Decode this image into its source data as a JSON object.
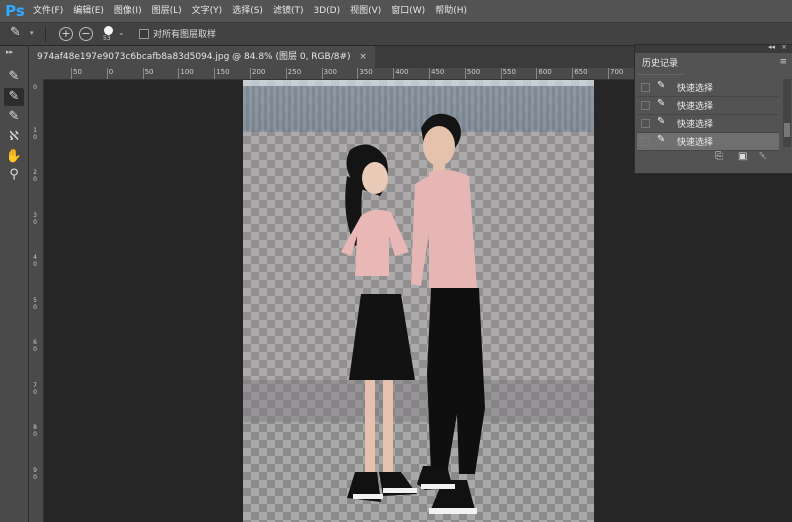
{
  "app": {
    "logo": "Ps"
  },
  "menu": [
    "文件(F)",
    "编辑(E)",
    "图像(I)",
    "图层(L)",
    "文字(Y)",
    "选择(S)",
    "滤镜(T)",
    "3D(D)",
    "视图(V)",
    "窗口(W)",
    "帮助(H)"
  ],
  "options": {
    "brush_size": "53",
    "sample_all_label": "对所有图层取样",
    "add_symbol": "+",
    "subtract_symbol": "−",
    "chevron": "⌄"
  },
  "document": {
    "tab_title": "974af48e197e9073c6bcafb8a83d5094.jpg @ 84.8% (图层 0, RGB/8#)",
    "close_glyph": "×"
  },
  "ruler": {
    "h_labels": [
      "50",
      "0",
      "50",
      "100",
      "150",
      "200",
      "250",
      "300",
      "350",
      "400",
      "450",
      "500",
      "550",
      "600",
      "650",
      "700",
      "750",
      "800",
      "850",
      "900",
      "950",
      "1000"
    ],
    "v_labels": [
      "0",
      "1\n0",
      "2\n0",
      "3\n0",
      "4\n0",
      "5\n0",
      "6\n0",
      "7\n0",
      "8\n0",
      "9\n0"
    ]
  },
  "history": {
    "tab_label": "历史记录",
    "menu_glyph": "≡",
    "collapse_glyph": "◂◂",
    "close_glyph": "×",
    "items": [
      {
        "label": "快速选择",
        "selected": false
      },
      {
        "label": "快速选择",
        "selected": false
      },
      {
        "label": "快速选择",
        "selected": false
      },
      {
        "label": "快速选择",
        "selected": true
      }
    ]
  },
  "icons": {
    "quick-select-icon": "quick-select",
    "lasso-icon": "lasso",
    "hand-icon": "hand",
    "zoom-icon": "zoom"
  }
}
